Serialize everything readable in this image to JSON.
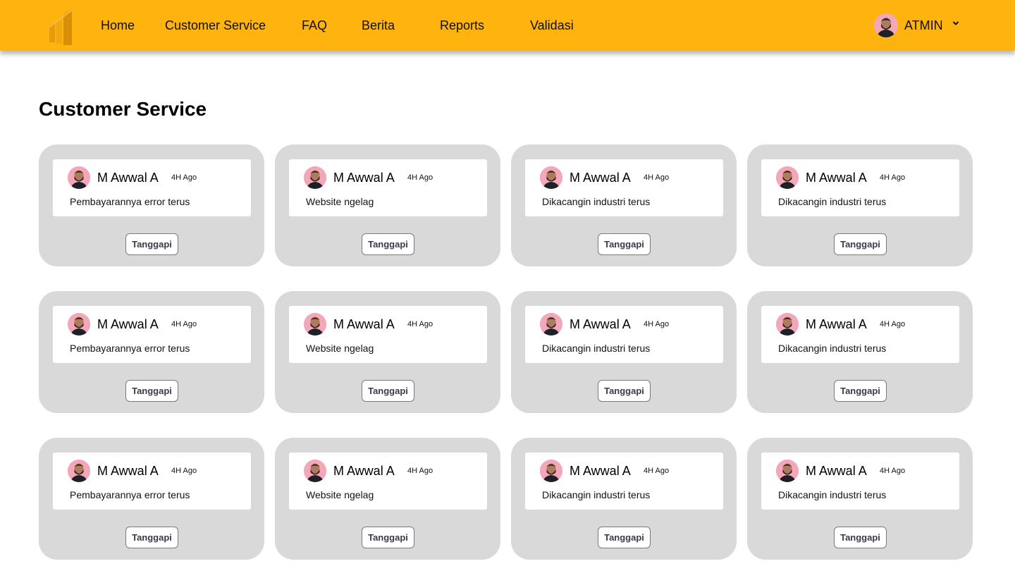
{
  "colors": {
    "header_bg": "#FFB30F",
    "card_bg": "#D9D9D9",
    "avatar_bg": "#F4A7B9"
  },
  "header": {
    "logo_icon": "bars-logo-icon",
    "nav": [
      "Home",
      "Customer Service",
      "FAQ",
      "Berita",
      "Reports",
      "Validasi"
    ],
    "user": {
      "name": "ATMIN",
      "avatar_icon": "user-avatar-icon",
      "caret_icon": "chevron-down-icon"
    }
  },
  "main": {
    "title": "Customer Service",
    "tickets": [
      {
        "author": "M Awwal A",
        "time": "4H Ago",
        "message": "Pembayarannya error terus",
        "button": "Tanggapi"
      },
      {
        "author": "M Awwal A",
        "time": "4H Ago",
        "message": "Website ngelag",
        "button": "Tanggapi"
      },
      {
        "author": "M Awwal A",
        "time": "4H Ago",
        "message": "Dikacangin industri terus",
        "button": "Tanggapi"
      },
      {
        "author": "M Awwal A",
        "time": "4H Ago",
        "message": "Dikacangin industri terus",
        "button": "Tanggapi"
      },
      {
        "author": "M Awwal A",
        "time": "4H Ago",
        "message": "Pembayarannya error terus",
        "button": "Tanggapi"
      },
      {
        "author": "M Awwal A",
        "time": "4H Ago",
        "message": "Website ngelag",
        "button": "Tanggapi"
      },
      {
        "author": "M Awwal A",
        "time": "4H Ago",
        "message": "Dikacangin industri terus",
        "button": "Tanggapi"
      },
      {
        "author": "M Awwal A",
        "time": "4H Ago",
        "message": "Dikacangin industri terus",
        "button": "Tanggapi"
      },
      {
        "author": "M Awwal A",
        "time": "4H Ago",
        "message": "Pembayarannya error terus",
        "button": "Tanggapi"
      },
      {
        "author": "M Awwal A",
        "time": "4H Ago",
        "message": "Website ngelag",
        "button": "Tanggapi"
      },
      {
        "author": "M Awwal A",
        "time": "4H Ago",
        "message": "Dikacangin industri terus",
        "button": "Tanggapi"
      },
      {
        "author": "M Awwal A",
        "time": "4H Ago",
        "message": "Dikacangin industri terus",
        "button": "Tanggapi"
      }
    ]
  }
}
